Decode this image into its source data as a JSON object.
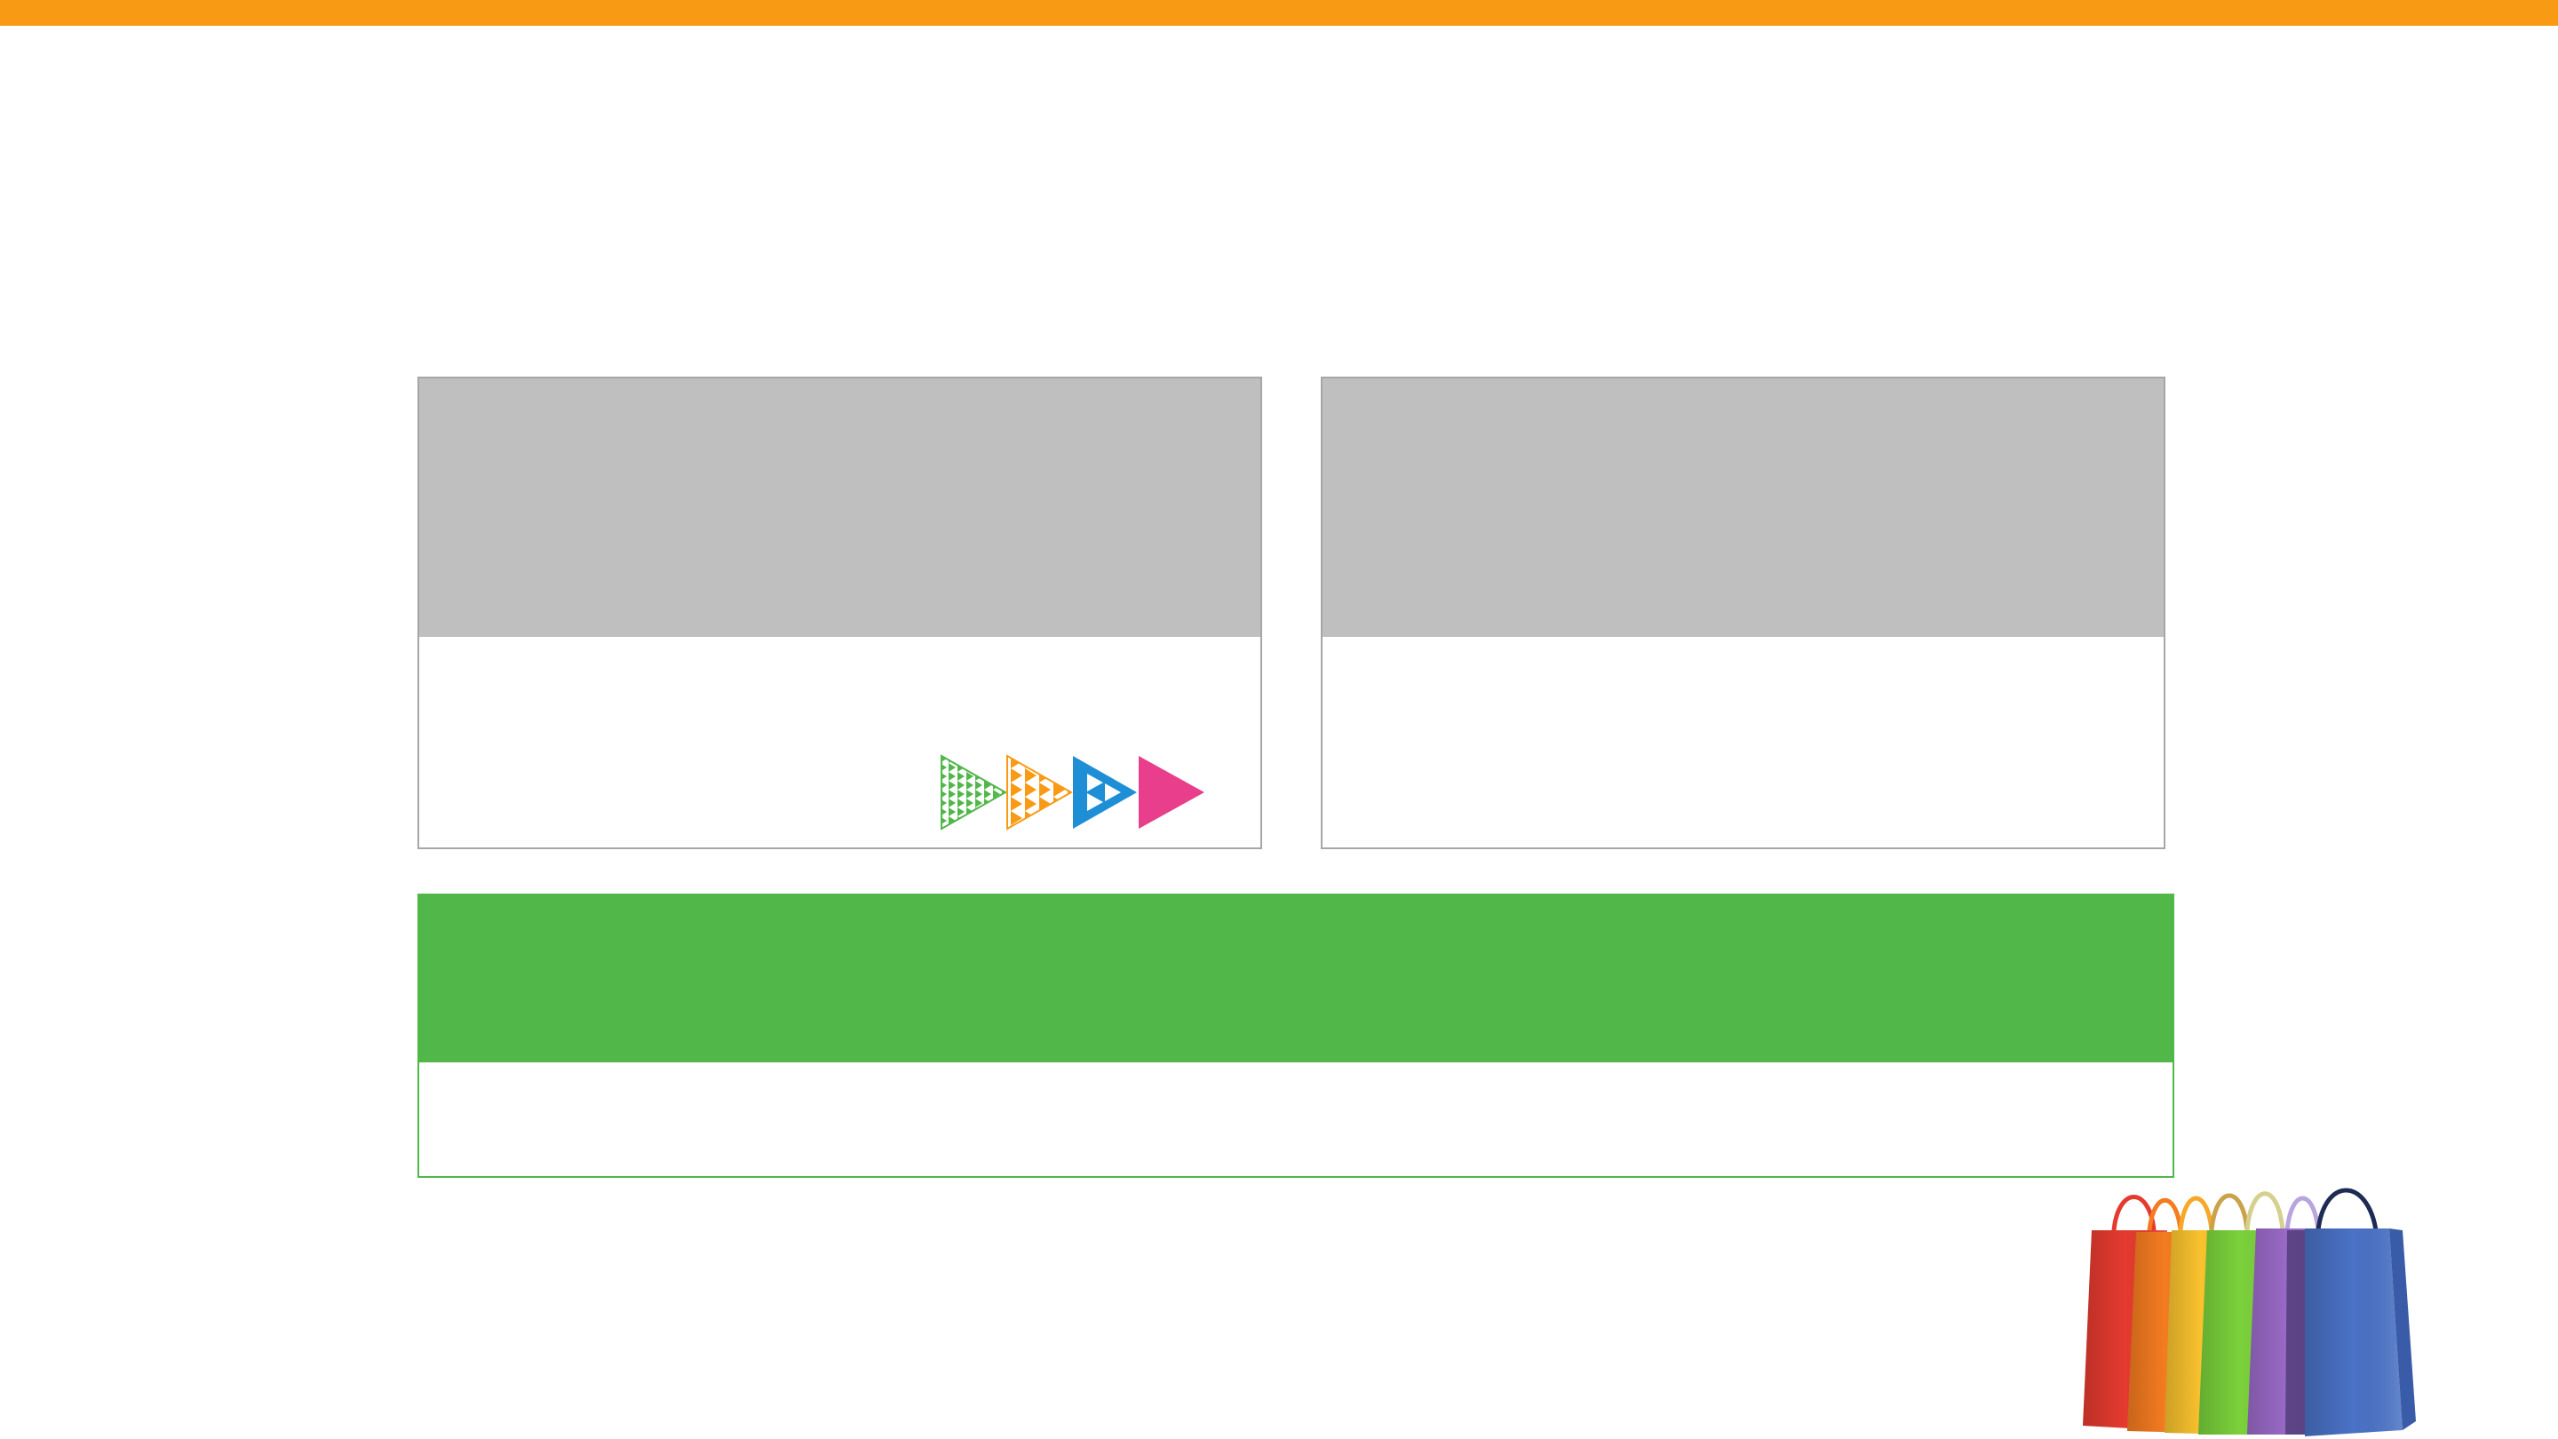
{
  "slide": {
    "accent_color": "#F99A14",
    "title": ""
  },
  "cards": {
    "left": {
      "header_color": "#BFBFBF",
      "header_text": "",
      "body_text": ""
    },
    "right": {
      "header_color": "#BFBFBF",
      "header_text": "",
      "body_text": ""
    },
    "wide": {
      "header_color": "#51B749",
      "header_text": "",
      "body_text": ""
    }
  },
  "decorations": {
    "arrow_logo_colors": [
      "#51B749",
      "#F99A14",
      "#1E8FD6",
      "#E83E8C"
    ],
    "image": "shopping-bags-image"
  }
}
